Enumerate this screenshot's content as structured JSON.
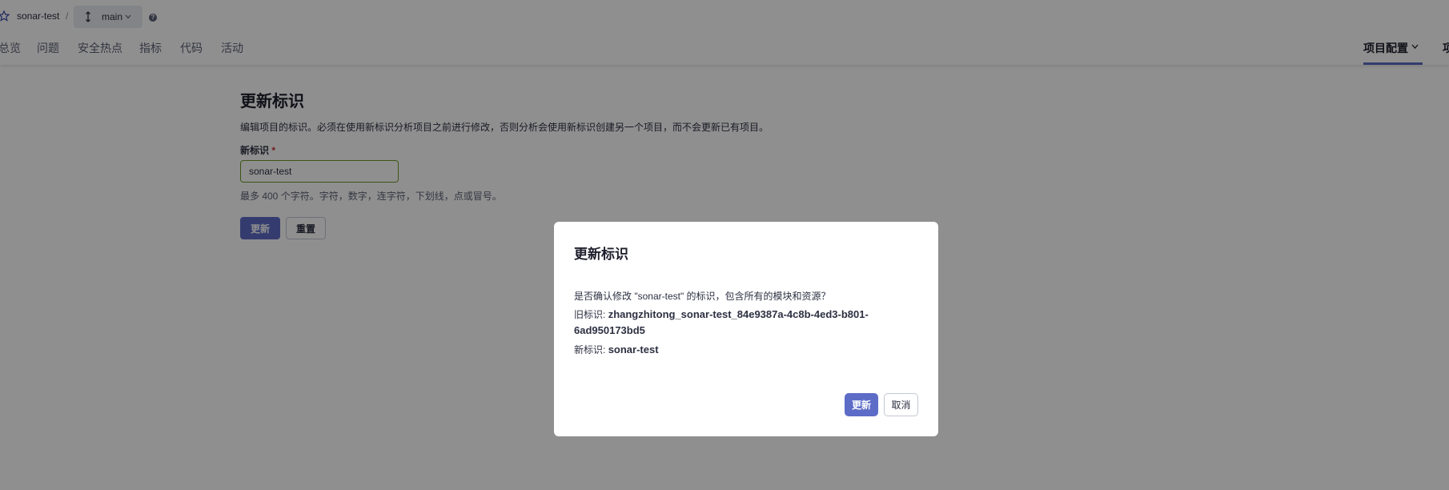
{
  "header": {
    "project_name": "sonar-test",
    "separator": "/",
    "branch": "main",
    "help_symbol": "?",
    "icons": [
      "star-icon",
      "branch-icon",
      "chevron-down-icon",
      "help-icon"
    ]
  },
  "nav": {
    "tabs": [
      "总览",
      "问题",
      "安全热点",
      "指标",
      "代码",
      "活动"
    ],
    "right_tabs": [
      "项目配置",
      "项"
    ]
  },
  "page": {
    "title": "更新标识",
    "description": "编辑项目的标识。必须在使用新标识分析项目之前进行修改，否则分析会使用新标识创建另一个项目，而不会更新已有项目。",
    "field_label": "新标识",
    "required_mark": "*",
    "input_value": "sonar-test",
    "hint": "最多 400 个字符。字符，数字，连字符，下划线，点或冒号。",
    "update_button": "更新",
    "reset_button": "重置"
  },
  "modal": {
    "title": "更新标识",
    "confirm_text": "是否确认修改 \"sonar-test\" 的标识，包含所有的模块和资源？",
    "old_label": "旧标识:",
    "old_value": "zhangzhitong_sonar-test_84e9387a-4c8b-4ed3-b801-6ad950173bd5",
    "new_label": "新标识:",
    "new_value": "sonar-test",
    "update_button": "更新",
    "cancel_button": "取消"
  },
  "colors": {
    "accent": "#5d6cc7",
    "overlay": "rgba(0,0,0,0.44)",
    "input_border": "#6b9a2a",
    "required": "#d02f3a"
  }
}
